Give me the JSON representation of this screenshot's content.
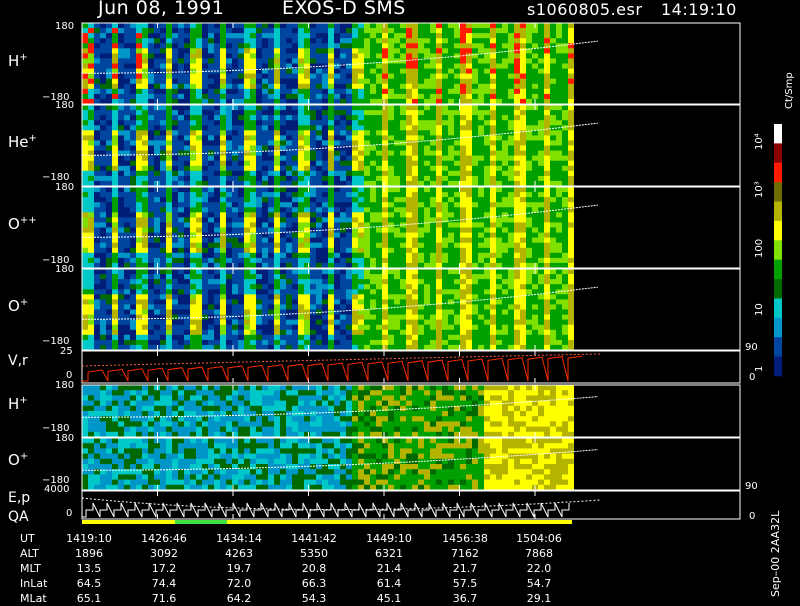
{
  "header": {
    "date_title": "Jun 08, 1991",
    "instrument": "EXOS-D SMS",
    "file": "s1060805.esr",
    "time": "14:19:10"
  },
  "panels": [
    {
      "species": "H",
      "charge": "+",
      "ytop": "180",
      "ybot": "−180"
    },
    {
      "species": "He",
      "charge": "+",
      "ytop": "180",
      "ybot": "−180"
    },
    {
      "species": "O",
      "charge": "++",
      "ytop": "180",
      "ybot": "−180"
    },
    {
      "species": "O",
      "charge": "+",
      "ytop": "180",
      "ybot": "−180"
    },
    {
      "species": "V,r",
      "charge": "",
      "ytop": "25",
      "ybot": "0",
      "rtop": "90",
      "rbot": "0"
    },
    {
      "species": "H",
      "charge": "+",
      "ytop": "180",
      "ybot": "−180"
    },
    {
      "species": "O",
      "charge": "+",
      "ytop": "180",
      "ybot": "−180"
    },
    {
      "species": "E,p",
      "species2": "QA",
      "charge": "",
      "ytop": "4000",
      "ybot": "0",
      "rtop": "90",
      "rbot": "0"
    }
  ],
  "colorbar": {
    "unit": "Ct/Smp",
    "labels": [
      "10⁴",
      "10³",
      "100",
      "10",
      "1"
    ],
    "colors": [
      "#ffffff",
      "#8c0000",
      "#ff1a00",
      "#6e6e00",
      "#b4b400",
      "#ffff00",
      "#80e000",
      "#00a000",
      "#006a00",
      "#00c8c8",
      "#0096c8",
      "#0046a0",
      "#001e78"
    ]
  },
  "side_label": "Sep–00 2AA32L",
  "table": {
    "row_labels": [
      "UT",
      "ALT",
      "MLT",
      "InLat",
      "MLat"
    ],
    "columns": [
      [
        "1419:10",
        "1896",
        "13.5",
        "64.5",
        "65.1"
      ],
      [
        "1426:46",
        "3092",
        "17.2",
        "74.4",
        "71.6"
      ],
      [
        "1434:14",
        "4263",
        "19.7",
        "72.0",
        "64.2"
      ],
      [
        "1441:42",
        "5350",
        "20.8",
        "66.3",
        "54.3"
      ],
      [
        "1449:10",
        "6321",
        "21.4",
        "61.4",
        "45.1"
      ],
      [
        "1456:38",
        "7162",
        "21.7",
        "57.5",
        "36.7"
      ],
      [
        "1504:06",
        "7868",
        "22.0",
        "54.7",
        "29.1"
      ]
    ]
  },
  "chart_data": {
    "type": "heatmap",
    "title": "Jun 08, 1991   EXOS-D SMS",
    "x_ticks": [
      "1419:10",
      "1426:46",
      "1434:14",
      "1441:42",
      "1449:10",
      "1456:38",
      "1504:06"
    ],
    "panels": [
      "H+",
      "He+",
      "O++",
      "O+",
      "V,r",
      "H+",
      "O+",
      "E,p"
    ],
    "y_range_pitch": [
      -180,
      180
    ],
    "color_scale": "log",
    "color_range": [
      1,
      10000
    ],
    "color_unit": "Ct/Smp"
  }
}
